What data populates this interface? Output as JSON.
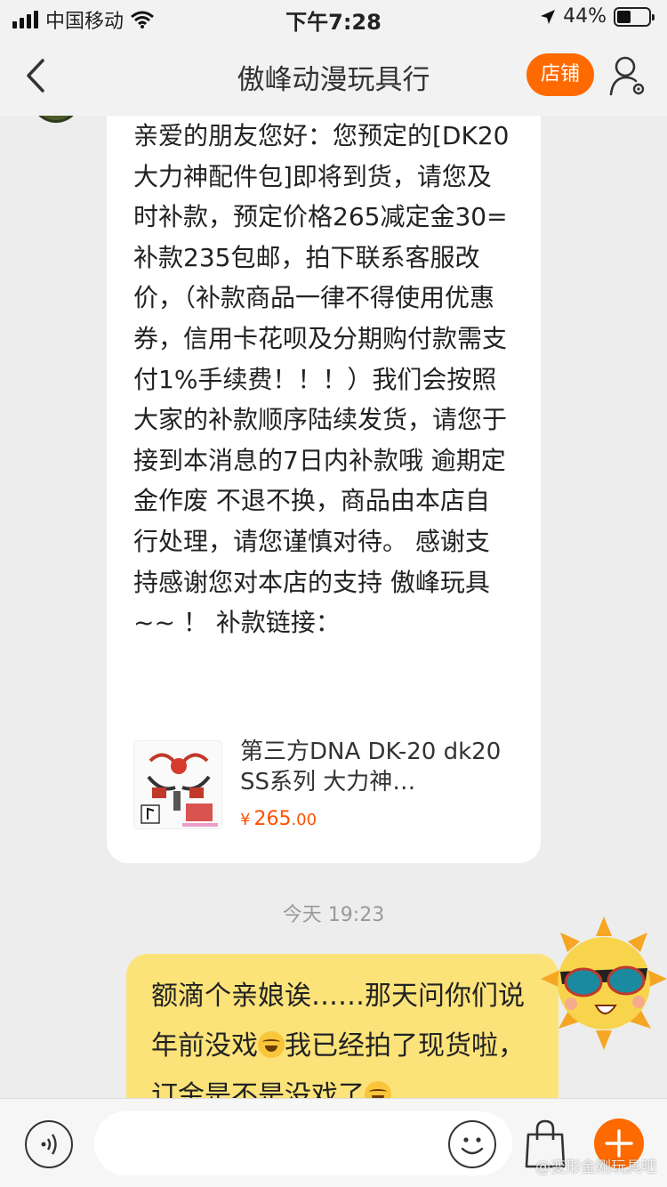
{
  "status_bar": {
    "carrier": "中国移动",
    "time": "下午7:28",
    "battery": "44%",
    "battery_level": 0.44
  },
  "header": {
    "title": "傲峰动漫玩具行",
    "shop_label": "店铺"
  },
  "chat": {
    "incoming_text": "亲爱的朋友您好：您预定的[DK20大力神配件包]即将到货，请您及时补款，预定价格265减定金30=补款235包邮，拍下联系客服改价，（补款商品一律不得使用优惠券，信用卡花呗及分期购付款需支付1%手续费！！！）我们会按照大家的补款顺序陆续发货，请您于接到本消息的7日内补款哦 逾期定金作废 不退不换，商品由本店自行处理，请您谨慎对待。 感谢支持感谢您对本店的支持 傲峰玩具 ~~ ！ 补款链接：",
    "product": {
      "title": "第三方DNA DK-20 dk20 SS系列 大力神…",
      "price_symbol": "¥",
      "price_main": "265",
      "price_cents": ".00"
    },
    "time_separator": "今天 19:23",
    "outgoing": {
      "part1": "额滴个亲娘诶……那天问你们说年前没戏",
      "part2": "我已经拍了现货啦，订金是不是没戏了"
    }
  },
  "input_bar": {
    "watermark": "@变形金刚玩具吧"
  },
  "colors": {
    "accent": "#ff6a00",
    "outgoing_bubble": "#fbe37a",
    "price": "#ff5000"
  }
}
